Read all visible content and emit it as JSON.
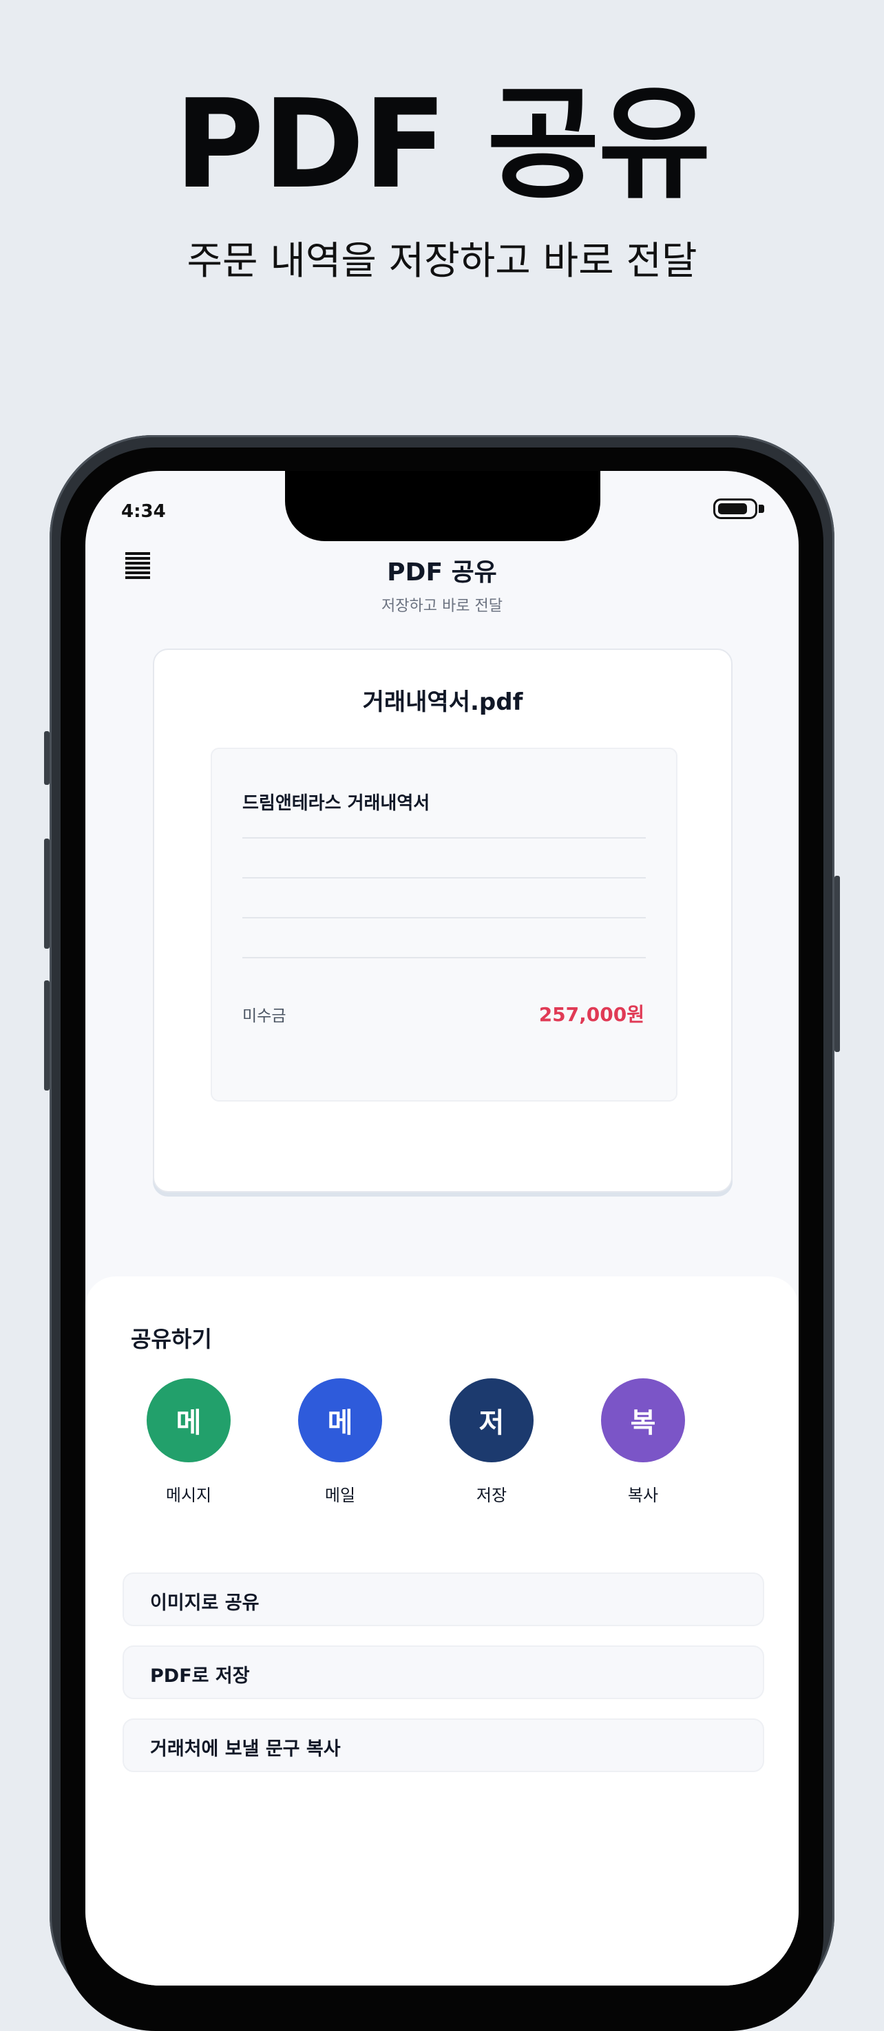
{
  "hero": {
    "title": "PDF 공유",
    "subtitle": "주문 내역을 저장하고 바로 전달"
  },
  "status_bar": {
    "time": "4:34",
    "battery_icon": "battery-icon"
  },
  "nav": {
    "menu_icon": "menu-icon",
    "title": "PDF 공유",
    "subtitle": "저장하고 바로 전달"
  },
  "document": {
    "file_name": "거래내역서.pdf",
    "preview_title": "드림앤테라스 거래내역서",
    "amount_label": "미수금",
    "amount_value": "257,000원"
  },
  "share": {
    "heading": "공유하기",
    "options": [
      {
        "glyph": "메",
        "label": "메시지",
        "color": "#22A06B",
        "icon": "message-icon"
      },
      {
        "glyph": "메",
        "label": "메일",
        "color": "#2E5BDB",
        "icon": "mail-icon"
      },
      {
        "glyph": "저",
        "label": "저장",
        "color": "#1C3A6E",
        "icon": "save-icon"
      },
      {
        "glyph": "복",
        "label": "복사",
        "color": "#7B55C7",
        "icon": "copy-icon"
      }
    ],
    "actions": [
      {
        "label": "이미지로 공유"
      },
      {
        "label": "PDF로 저장"
      },
      {
        "label": "거래처에 보낼 문구 복사"
      }
    ]
  }
}
